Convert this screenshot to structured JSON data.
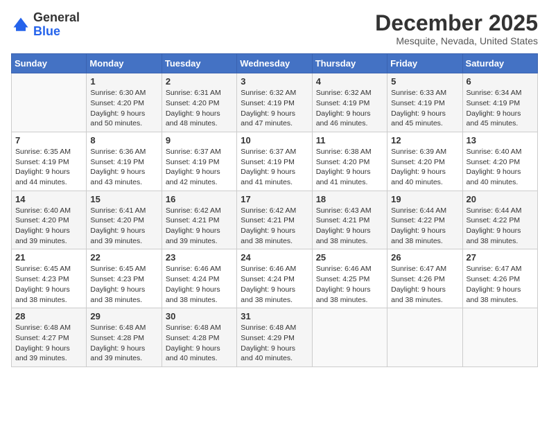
{
  "header": {
    "logo_general": "General",
    "logo_blue": "Blue",
    "month_title": "December 2025",
    "location": "Mesquite, Nevada, United States"
  },
  "days_of_week": [
    "Sunday",
    "Monday",
    "Tuesday",
    "Wednesday",
    "Thursday",
    "Friday",
    "Saturday"
  ],
  "weeks": [
    [
      {
        "num": "",
        "sunrise": "",
        "sunset": "",
        "daylight": ""
      },
      {
        "num": "1",
        "sunrise": "Sunrise: 6:30 AM",
        "sunset": "Sunset: 4:20 PM",
        "daylight": "Daylight: 9 hours and 50 minutes."
      },
      {
        "num": "2",
        "sunrise": "Sunrise: 6:31 AM",
        "sunset": "Sunset: 4:20 PM",
        "daylight": "Daylight: 9 hours and 48 minutes."
      },
      {
        "num": "3",
        "sunrise": "Sunrise: 6:32 AM",
        "sunset": "Sunset: 4:19 PM",
        "daylight": "Daylight: 9 hours and 47 minutes."
      },
      {
        "num": "4",
        "sunrise": "Sunrise: 6:32 AM",
        "sunset": "Sunset: 4:19 PM",
        "daylight": "Daylight: 9 hours and 46 minutes."
      },
      {
        "num": "5",
        "sunrise": "Sunrise: 6:33 AM",
        "sunset": "Sunset: 4:19 PM",
        "daylight": "Daylight: 9 hours and 45 minutes."
      },
      {
        "num": "6",
        "sunrise": "Sunrise: 6:34 AM",
        "sunset": "Sunset: 4:19 PM",
        "daylight": "Daylight: 9 hours and 45 minutes."
      }
    ],
    [
      {
        "num": "7",
        "sunrise": "Sunrise: 6:35 AM",
        "sunset": "Sunset: 4:19 PM",
        "daylight": "Daylight: 9 hours and 44 minutes."
      },
      {
        "num": "8",
        "sunrise": "Sunrise: 6:36 AM",
        "sunset": "Sunset: 4:19 PM",
        "daylight": "Daylight: 9 hours and 43 minutes."
      },
      {
        "num": "9",
        "sunrise": "Sunrise: 6:37 AM",
        "sunset": "Sunset: 4:19 PM",
        "daylight": "Daylight: 9 hours and 42 minutes."
      },
      {
        "num": "10",
        "sunrise": "Sunrise: 6:37 AM",
        "sunset": "Sunset: 4:19 PM",
        "daylight": "Daylight: 9 hours and 41 minutes."
      },
      {
        "num": "11",
        "sunrise": "Sunrise: 6:38 AM",
        "sunset": "Sunset: 4:20 PM",
        "daylight": "Daylight: 9 hours and 41 minutes."
      },
      {
        "num": "12",
        "sunrise": "Sunrise: 6:39 AM",
        "sunset": "Sunset: 4:20 PM",
        "daylight": "Daylight: 9 hours and 40 minutes."
      },
      {
        "num": "13",
        "sunrise": "Sunrise: 6:40 AM",
        "sunset": "Sunset: 4:20 PM",
        "daylight": "Daylight: 9 hours and 40 minutes."
      }
    ],
    [
      {
        "num": "14",
        "sunrise": "Sunrise: 6:40 AM",
        "sunset": "Sunset: 4:20 PM",
        "daylight": "Daylight: 9 hours and 39 minutes."
      },
      {
        "num": "15",
        "sunrise": "Sunrise: 6:41 AM",
        "sunset": "Sunset: 4:20 PM",
        "daylight": "Daylight: 9 hours and 39 minutes."
      },
      {
        "num": "16",
        "sunrise": "Sunrise: 6:42 AM",
        "sunset": "Sunset: 4:21 PM",
        "daylight": "Daylight: 9 hours and 39 minutes."
      },
      {
        "num": "17",
        "sunrise": "Sunrise: 6:42 AM",
        "sunset": "Sunset: 4:21 PM",
        "daylight": "Daylight: 9 hours and 38 minutes."
      },
      {
        "num": "18",
        "sunrise": "Sunrise: 6:43 AM",
        "sunset": "Sunset: 4:21 PM",
        "daylight": "Daylight: 9 hours and 38 minutes."
      },
      {
        "num": "19",
        "sunrise": "Sunrise: 6:44 AM",
        "sunset": "Sunset: 4:22 PM",
        "daylight": "Daylight: 9 hours and 38 minutes."
      },
      {
        "num": "20",
        "sunrise": "Sunrise: 6:44 AM",
        "sunset": "Sunset: 4:22 PM",
        "daylight": "Daylight: 9 hours and 38 minutes."
      }
    ],
    [
      {
        "num": "21",
        "sunrise": "Sunrise: 6:45 AM",
        "sunset": "Sunset: 4:23 PM",
        "daylight": "Daylight: 9 hours and 38 minutes."
      },
      {
        "num": "22",
        "sunrise": "Sunrise: 6:45 AM",
        "sunset": "Sunset: 4:23 PM",
        "daylight": "Daylight: 9 hours and 38 minutes."
      },
      {
        "num": "23",
        "sunrise": "Sunrise: 6:46 AM",
        "sunset": "Sunset: 4:24 PM",
        "daylight": "Daylight: 9 hours and 38 minutes."
      },
      {
        "num": "24",
        "sunrise": "Sunrise: 6:46 AM",
        "sunset": "Sunset: 4:24 PM",
        "daylight": "Daylight: 9 hours and 38 minutes."
      },
      {
        "num": "25",
        "sunrise": "Sunrise: 6:46 AM",
        "sunset": "Sunset: 4:25 PM",
        "daylight": "Daylight: 9 hours and 38 minutes."
      },
      {
        "num": "26",
        "sunrise": "Sunrise: 6:47 AM",
        "sunset": "Sunset: 4:26 PM",
        "daylight": "Daylight: 9 hours and 38 minutes."
      },
      {
        "num": "27",
        "sunrise": "Sunrise: 6:47 AM",
        "sunset": "Sunset: 4:26 PM",
        "daylight": "Daylight: 9 hours and 38 minutes."
      }
    ],
    [
      {
        "num": "28",
        "sunrise": "Sunrise: 6:48 AM",
        "sunset": "Sunset: 4:27 PM",
        "daylight": "Daylight: 9 hours and 39 minutes."
      },
      {
        "num": "29",
        "sunrise": "Sunrise: 6:48 AM",
        "sunset": "Sunset: 4:28 PM",
        "daylight": "Daylight: 9 hours and 39 minutes."
      },
      {
        "num": "30",
        "sunrise": "Sunrise: 6:48 AM",
        "sunset": "Sunset: 4:28 PM",
        "daylight": "Daylight: 9 hours and 40 minutes."
      },
      {
        "num": "31",
        "sunrise": "Sunrise: 6:48 AM",
        "sunset": "Sunset: 4:29 PM",
        "daylight": "Daylight: 9 hours and 40 minutes."
      },
      {
        "num": "",
        "sunrise": "",
        "sunset": "",
        "daylight": ""
      },
      {
        "num": "",
        "sunrise": "",
        "sunset": "",
        "daylight": ""
      },
      {
        "num": "",
        "sunrise": "",
        "sunset": "",
        "daylight": ""
      }
    ]
  ]
}
